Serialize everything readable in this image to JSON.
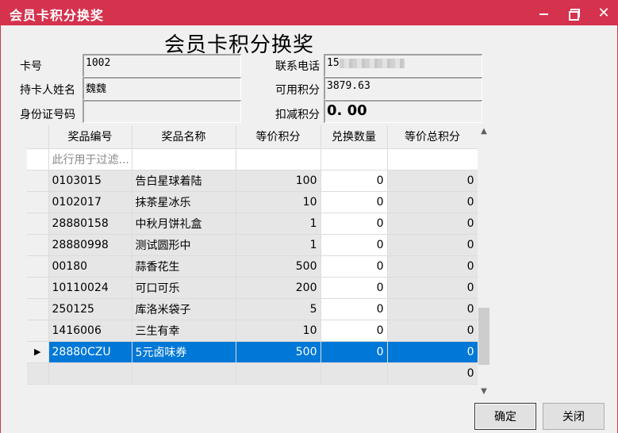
{
  "window": {
    "title": "会员卡积分换奖"
  },
  "form": {
    "heading": "会员卡积分换奖",
    "card_no_label": "卡号",
    "card_no_value": "1002",
    "holder_label": "持卡人姓名",
    "holder_value": "魏魏",
    "id_label": "身份证号码",
    "id_value": "",
    "phone_label": "联系电话",
    "phone_value": "15",
    "points_label": "可用积分",
    "points_value": "3879.63",
    "deduct_label": "扣减积分",
    "deduct_value": "0. 00"
  },
  "grid": {
    "columns": [
      "奖品编号",
      "奖品名称",
      "等价积分",
      "兑换数量",
      "等价总积分"
    ],
    "filter_placeholder": "此行用于过滤...",
    "rows": [
      {
        "code": "0103015",
        "name": "告白星球着陆",
        "points": "100",
        "qty": "0",
        "total": "0"
      },
      {
        "code": "0102017",
        "name": "抹茶星冰乐",
        "points": "10",
        "qty": "0",
        "total": "0"
      },
      {
        "code": "28880158",
        "name": "中秋月饼礼盒",
        "points": "1",
        "qty": "0",
        "total": "0"
      },
      {
        "code": "28880998",
        "name": "测试圆形中",
        "points": "1",
        "qty": "0",
        "total": "0"
      },
      {
        "code": "00180",
        "name": "蒜香花生",
        "points": "500",
        "qty": "0",
        "total": "0"
      },
      {
        "code": "10110024",
        "name": "可口可乐",
        "points": "200",
        "qty": "0",
        "total": "0"
      },
      {
        "code": "250125",
        "name": "库洛米袋子",
        "points": "5",
        "qty": "0",
        "total": "0"
      },
      {
        "code": "1416006",
        "name": "三生有幸",
        "points": "10",
        "qty": "0",
        "total": "0"
      },
      {
        "code": "28880CZU",
        "name": "5元卤味券",
        "points": "500",
        "qty": "0",
        "total": "0"
      }
    ],
    "summary_total": "0"
  },
  "buttons": {
    "ok": "确定",
    "close": "关闭"
  }
}
